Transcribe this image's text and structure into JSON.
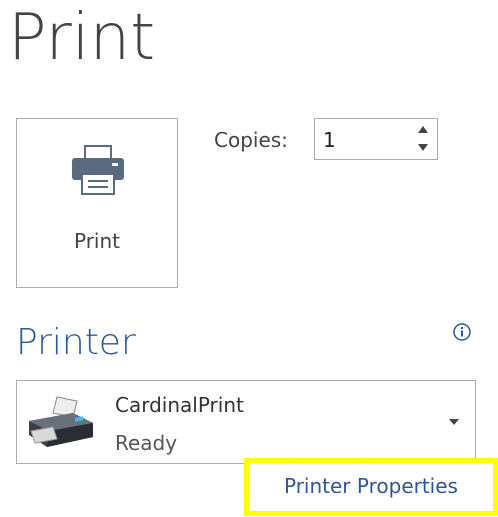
{
  "page": {
    "title": "Print"
  },
  "print_button": {
    "label": "Print",
    "icon": "printer-icon"
  },
  "copies": {
    "label": "Copies:",
    "value": "1"
  },
  "printer_section": {
    "title": "Printer",
    "info_icon": "info-icon",
    "selected_printer": {
      "name": "CardinalPrint",
      "status": "Ready",
      "icon": "printer-device-icon"
    },
    "properties_link": "Printer Properties"
  },
  "colors": {
    "accent": "#2b579a",
    "highlight": "#ffff00",
    "text": "#444444",
    "border": "#ababab"
  }
}
